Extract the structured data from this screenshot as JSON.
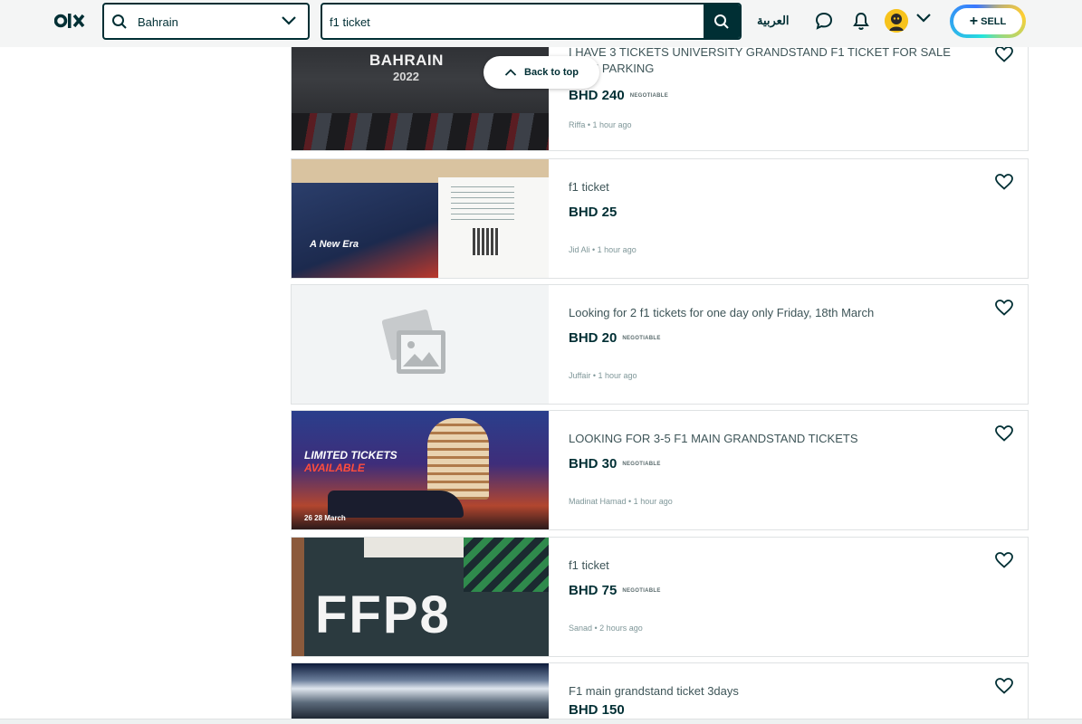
{
  "header": {
    "location": "Bahrain",
    "search_value": "f1 ticket",
    "language": "العربية",
    "sell_label": "SELL"
  },
  "back_to_top": "Back to top",
  "listings": [
    {
      "title": "I HAVE 3 TICKETS UNIVERSITY GRANDSTAND F1 TICKET FOR SALE WITH PARKING",
      "price": "BHD 240",
      "negotiable": "NEGOTIABLE",
      "meta": "Riffa • 1 hour ago",
      "thumb_text_1": "BAHRAIN",
      "thumb_text_2": "2022"
    },
    {
      "title": "f1 ticket",
      "price": "BHD 25",
      "negotiable": "",
      "meta": "Jid Ali • 1 hour ago",
      "thumb_text_1": "A New Era"
    },
    {
      "title": "Looking for 2 f1 tickets for one day only Friday, 18th March",
      "price": "BHD 20",
      "negotiable": "NEGOTIABLE",
      "meta": "Juffair • 1 hour ago"
    },
    {
      "title": "LOOKING FOR 3-5 F1 MAIN GRANDSTAND TICKETS",
      "price": "BHD 30",
      "negotiable": "NEGOTIABLE",
      "meta": "Madinat Hamad • 1 hour ago",
      "thumb_text_1": "LIMITED TICKETS",
      "thumb_text_2": "AVAILABLE",
      "thumb_text_3": "26 28 March"
    },
    {
      "title": "f1 ticket",
      "price": "BHD 75",
      "negotiable": "NEGOTIABLE",
      "meta": "Sanad • 2 hours ago",
      "thumb_text_1": "FFP8"
    },
    {
      "title": "F1 main grandstand ticket 3days",
      "price": "BHD 150",
      "negotiable": "",
      "meta": ""
    }
  ]
}
